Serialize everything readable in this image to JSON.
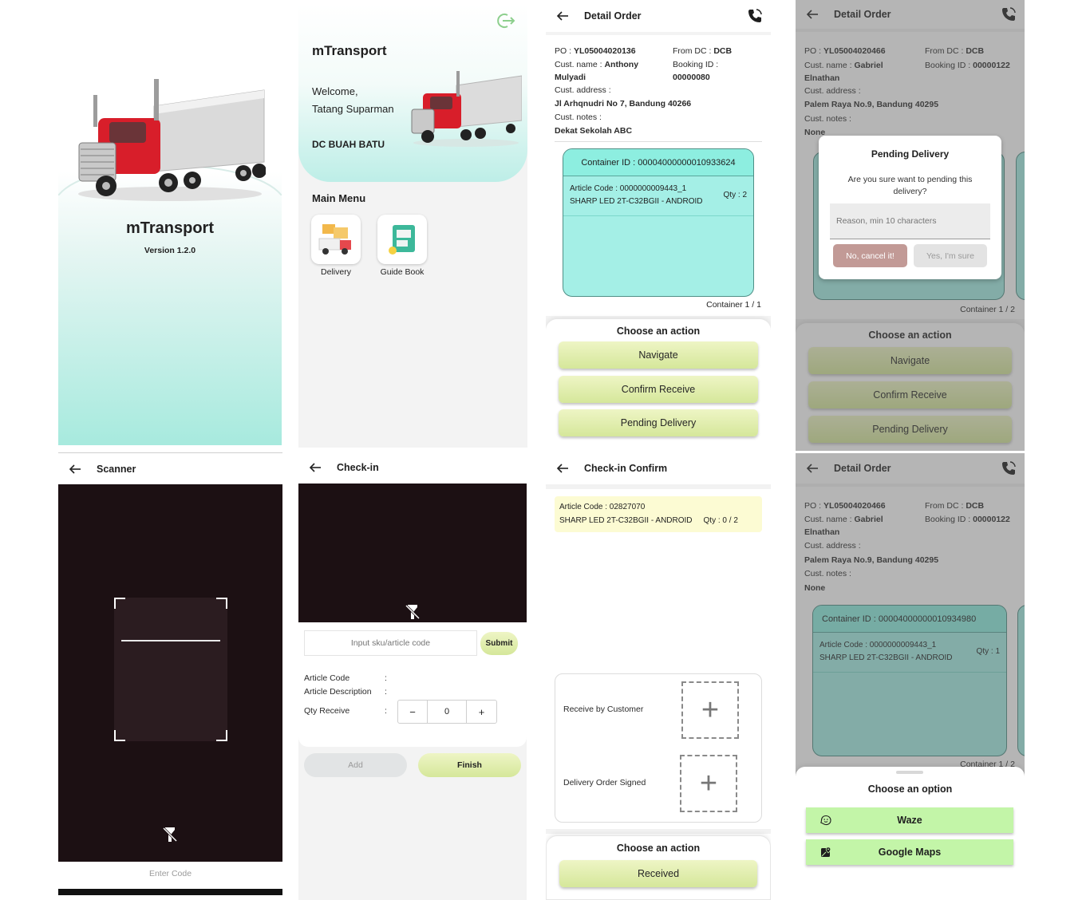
{
  "splash": {
    "app_name": "mTransport",
    "version": "Version 1.2.0"
  },
  "home": {
    "app_name": "mTransport",
    "welcome": "Welcome,",
    "user_name": "Tatang Suparman",
    "dc_name": "DC BUAH BATU",
    "main_menu_title": "Main Menu",
    "menu": [
      {
        "label": "Delivery",
        "icon": "delivery-icon"
      },
      {
        "label": "Guide Book",
        "icon": "guide-book-icon"
      }
    ]
  },
  "detail1": {
    "title": "Detail Order",
    "po_label": "PO : ",
    "po_value": "YL05004020136",
    "from_dc_label": "From DC : ",
    "from_dc_value": "DCB",
    "cust_name_label": "Cust. name : ",
    "cust_name_value_1": "Anthony",
    "cust_name_value_2": "Mulyadi",
    "booking_label": "Booking ID :",
    "booking_value": "00000080",
    "address_label": "Cust. address :",
    "address_value": "Jl Arhqnudri No 7, Bandung 40266",
    "notes_label": "Cust. notes :",
    "notes_value": "Dekat Sekolah ABC",
    "container_id": "Container ID : 00004000000010933624",
    "article_code": "Article Code : 0000000009443_1",
    "article_desc": "SHARP LED 2T-C32BGII - ANDROID",
    "qty": "Qty : 2",
    "container_count": "Container 1 / 1",
    "choose_action": "Choose an action",
    "actions": [
      "Navigate",
      "Confirm Receive",
      "Pending Delivery"
    ]
  },
  "pending": {
    "title": "Detail Order",
    "po_label": "PO : ",
    "po_value": "YL05004020466",
    "from_dc_label": "From DC : ",
    "from_dc_value": "DCB",
    "cust_name_label": "Cust. name : ",
    "cust_name_value_1": "Gabriel",
    "cust_name_value_2": "Elnathan",
    "booking_label": "Booking ID : ",
    "booking_value": "00000122",
    "address_label": "Cust. address :",
    "address_value": "Palem Raya No.9, Bandung 40295",
    "notes_label": "Cust. notes :",
    "notes_value": "None",
    "container_count": "Container 1 / 2",
    "choose_action": "Choose an action",
    "actions": [
      "Navigate",
      "Confirm Receive",
      "Pending Delivery"
    ],
    "dialog_title": "Pending Delivery",
    "dialog_message": "Are you sure want to pending this delivery?",
    "reason_placeholder": "Reason, min 10 characters",
    "cancel_label": "No, cancel it!",
    "confirm_label": "Yes, I'm sure"
  },
  "scanner": {
    "title": "Scanner",
    "enter_code": "Enter Code"
  },
  "checkin": {
    "title": "Check-in",
    "sku_placeholder": "Input sku/article code",
    "submit": "Submit",
    "article_code_label": "Article Code",
    "article_desc_label": "Article Description",
    "qty_receive_label": "Qty Receive",
    "colon": ":",
    "qty_value": "0",
    "minus": "−",
    "plus": "+",
    "add": "Add",
    "finish": "Finish"
  },
  "confirm": {
    "title": "Check-in Confirm",
    "article_code": "Article Code : 02827070",
    "article_desc": "SHARP LED 2T-C32BGII - ANDROID",
    "qty": "Qty : 0 / 2",
    "receive_by_customer": "Receive by Customer",
    "delivery_order_signed": "Delivery Order Signed",
    "choose_action": "Choose an action",
    "received": "Received"
  },
  "options": {
    "title": "Detail Order",
    "po_label": "PO : ",
    "po_value": "YL05004020466",
    "from_dc_label": "From DC : ",
    "from_dc_value": "DCB",
    "cust_name_label": "Cust. name : ",
    "cust_name_value_1": "Gabriel",
    "cust_name_value_2": "Elnathan",
    "booking_label": "Booking ID : ",
    "booking_value": "00000122",
    "address_label": "Cust. address :",
    "address_value": "Palem Raya No.9, Bandung 40295",
    "notes_label": "Cust. notes :",
    "notes_value": "None",
    "container_id": "Container ID : 00004000000010934980",
    "article_code": "Article Code : 0000000009443_1",
    "article_desc": "SHARP LED 2T-C32BGII - ANDROID",
    "qty": "Qty : 1",
    "container_count": "Container 1 / 2",
    "choose_option": "Choose an option",
    "waze": "Waze",
    "google_maps": "Google Maps"
  },
  "colors": {
    "accent_green": "#d5e79a",
    "teal_card": "#a4efe6",
    "option_green": "#c3f5a8",
    "header_mint": "#cdf3ee"
  }
}
